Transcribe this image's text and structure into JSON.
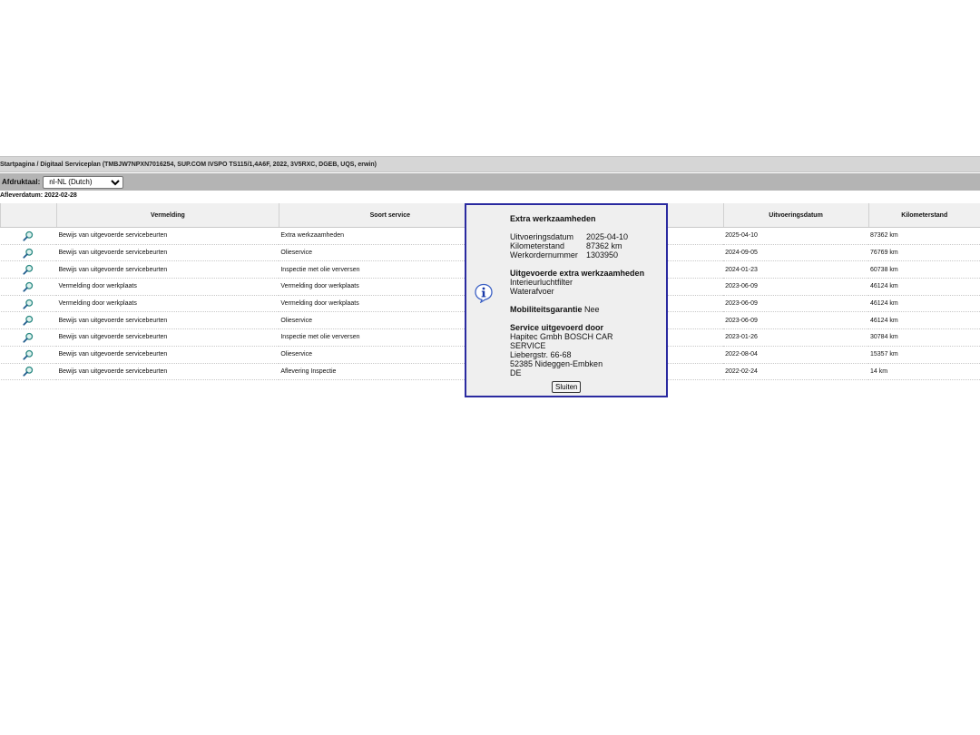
{
  "breadcrumb": "Startpagina / Digitaal Serviceplan (TMBJW7NPXN7016254, SUP.COM IVSPO TS115/1,4A6F, 2022, 3V5RXC, DGEB, UQS, erwin)",
  "print": {
    "label": "Afdruktaal:",
    "selected": "nl-NL (Dutch)"
  },
  "delivery_date": "Afleverdatum: 2022-02-28",
  "table": {
    "headers": [
      "",
      "Vermelding",
      "Soort service",
      "",
      "Uitvoeringsdatum",
      "Kilometerstand"
    ],
    "rows": [
      {
        "vermelding": "Bewijs van uitgevoerde servicebeurten",
        "soort": "Extra werkzaamheden",
        "datum": "2025-04-10",
        "km": "87362 km"
      },
      {
        "vermelding": "Bewijs van uitgevoerde servicebeurten",
        "soort": "Olieservice",
        "datum": "2024-09-05",
        "km": "76769 km"
      },
      {
        "vermelding": "Bewijs van uitgevoerde servicebeurten",
        "soort": "Inspectie met olie verversen",
        "datum": "2024-01-23",
        "km": "60738 km"
      },
      {
        "vermelding": "Vermelding door werkplaats",
        "soort": "Vermelding door werkplaats",
        "datum": "2023-06-09",
        "km": "46124 km"
      },
      {
        "vermelding": "Vermelding door werkplaats",
        "soort": "Vermelding door werkplaats",
        "datum": "2023-06-09",
        "km": "46124 km"
      },
      {
        "vermelding": "Bewijs van uitgevoerde servicebeurten",
        "soort": "Olieservice",
        "datum": "2023-06-09",
        "km": "46124 km"
      },
      {
        "vermelding": "Bewijs van uitgevoerde servicebeurten",
        "soort": "Inspectie met olie verversen",
        "datum": "2023-01-26",
        "km": "30784 km"
      },
      {
        "vermelding": "Bewijs van uitgevoerde servicebeurten",
        "soort": "Olieservice",
        "datum": "2022-08-04",
        "km": "15357 km"
      },
      {
        "vermelding": "Bewijs van uitgevoerde servicebeurten",
        "soort": "Aflevering Inspectie",
        "datum": "2022-02-24",
        "km": "14 km"
      }
    ]
  },
  "dialog": {
    "title": "Extra werkzaamheden",
    "execution_date_label": "Uitvoeringsdatum",
    "execution_date": "2025-04-10",
    "mileage_label": "Kilometerstand",
    "mileage": "87362 km",
    "order_number_label": "Werkordernummer",
    "order_number": "1303950",
    "extra_work_heading": "Uitgevoerde extra werkzaamheden",
    "extra_work_items": [
      "Interieurluchtfilter",
      "Waterafvoer"
    ],
    "mobility_label": "Mobiliteitsgarantie",
    "mobility_value": "Nee",
    "service_by_heading": "Service uitgevoerd door",
    "service_by_lines": [
      "Hapitec Gmbh BOSCH CAR",
      "SERVICE",
      "Liebergstr. 66-68",
      "52385 Nideggen-Embken",
      "DE"
    ],
    "close_label": "Sluiten"
  },
  "icons": {
    "row_icon": "magnifier-icon",
    "dialog_icon": "info-icon"
  }
}
